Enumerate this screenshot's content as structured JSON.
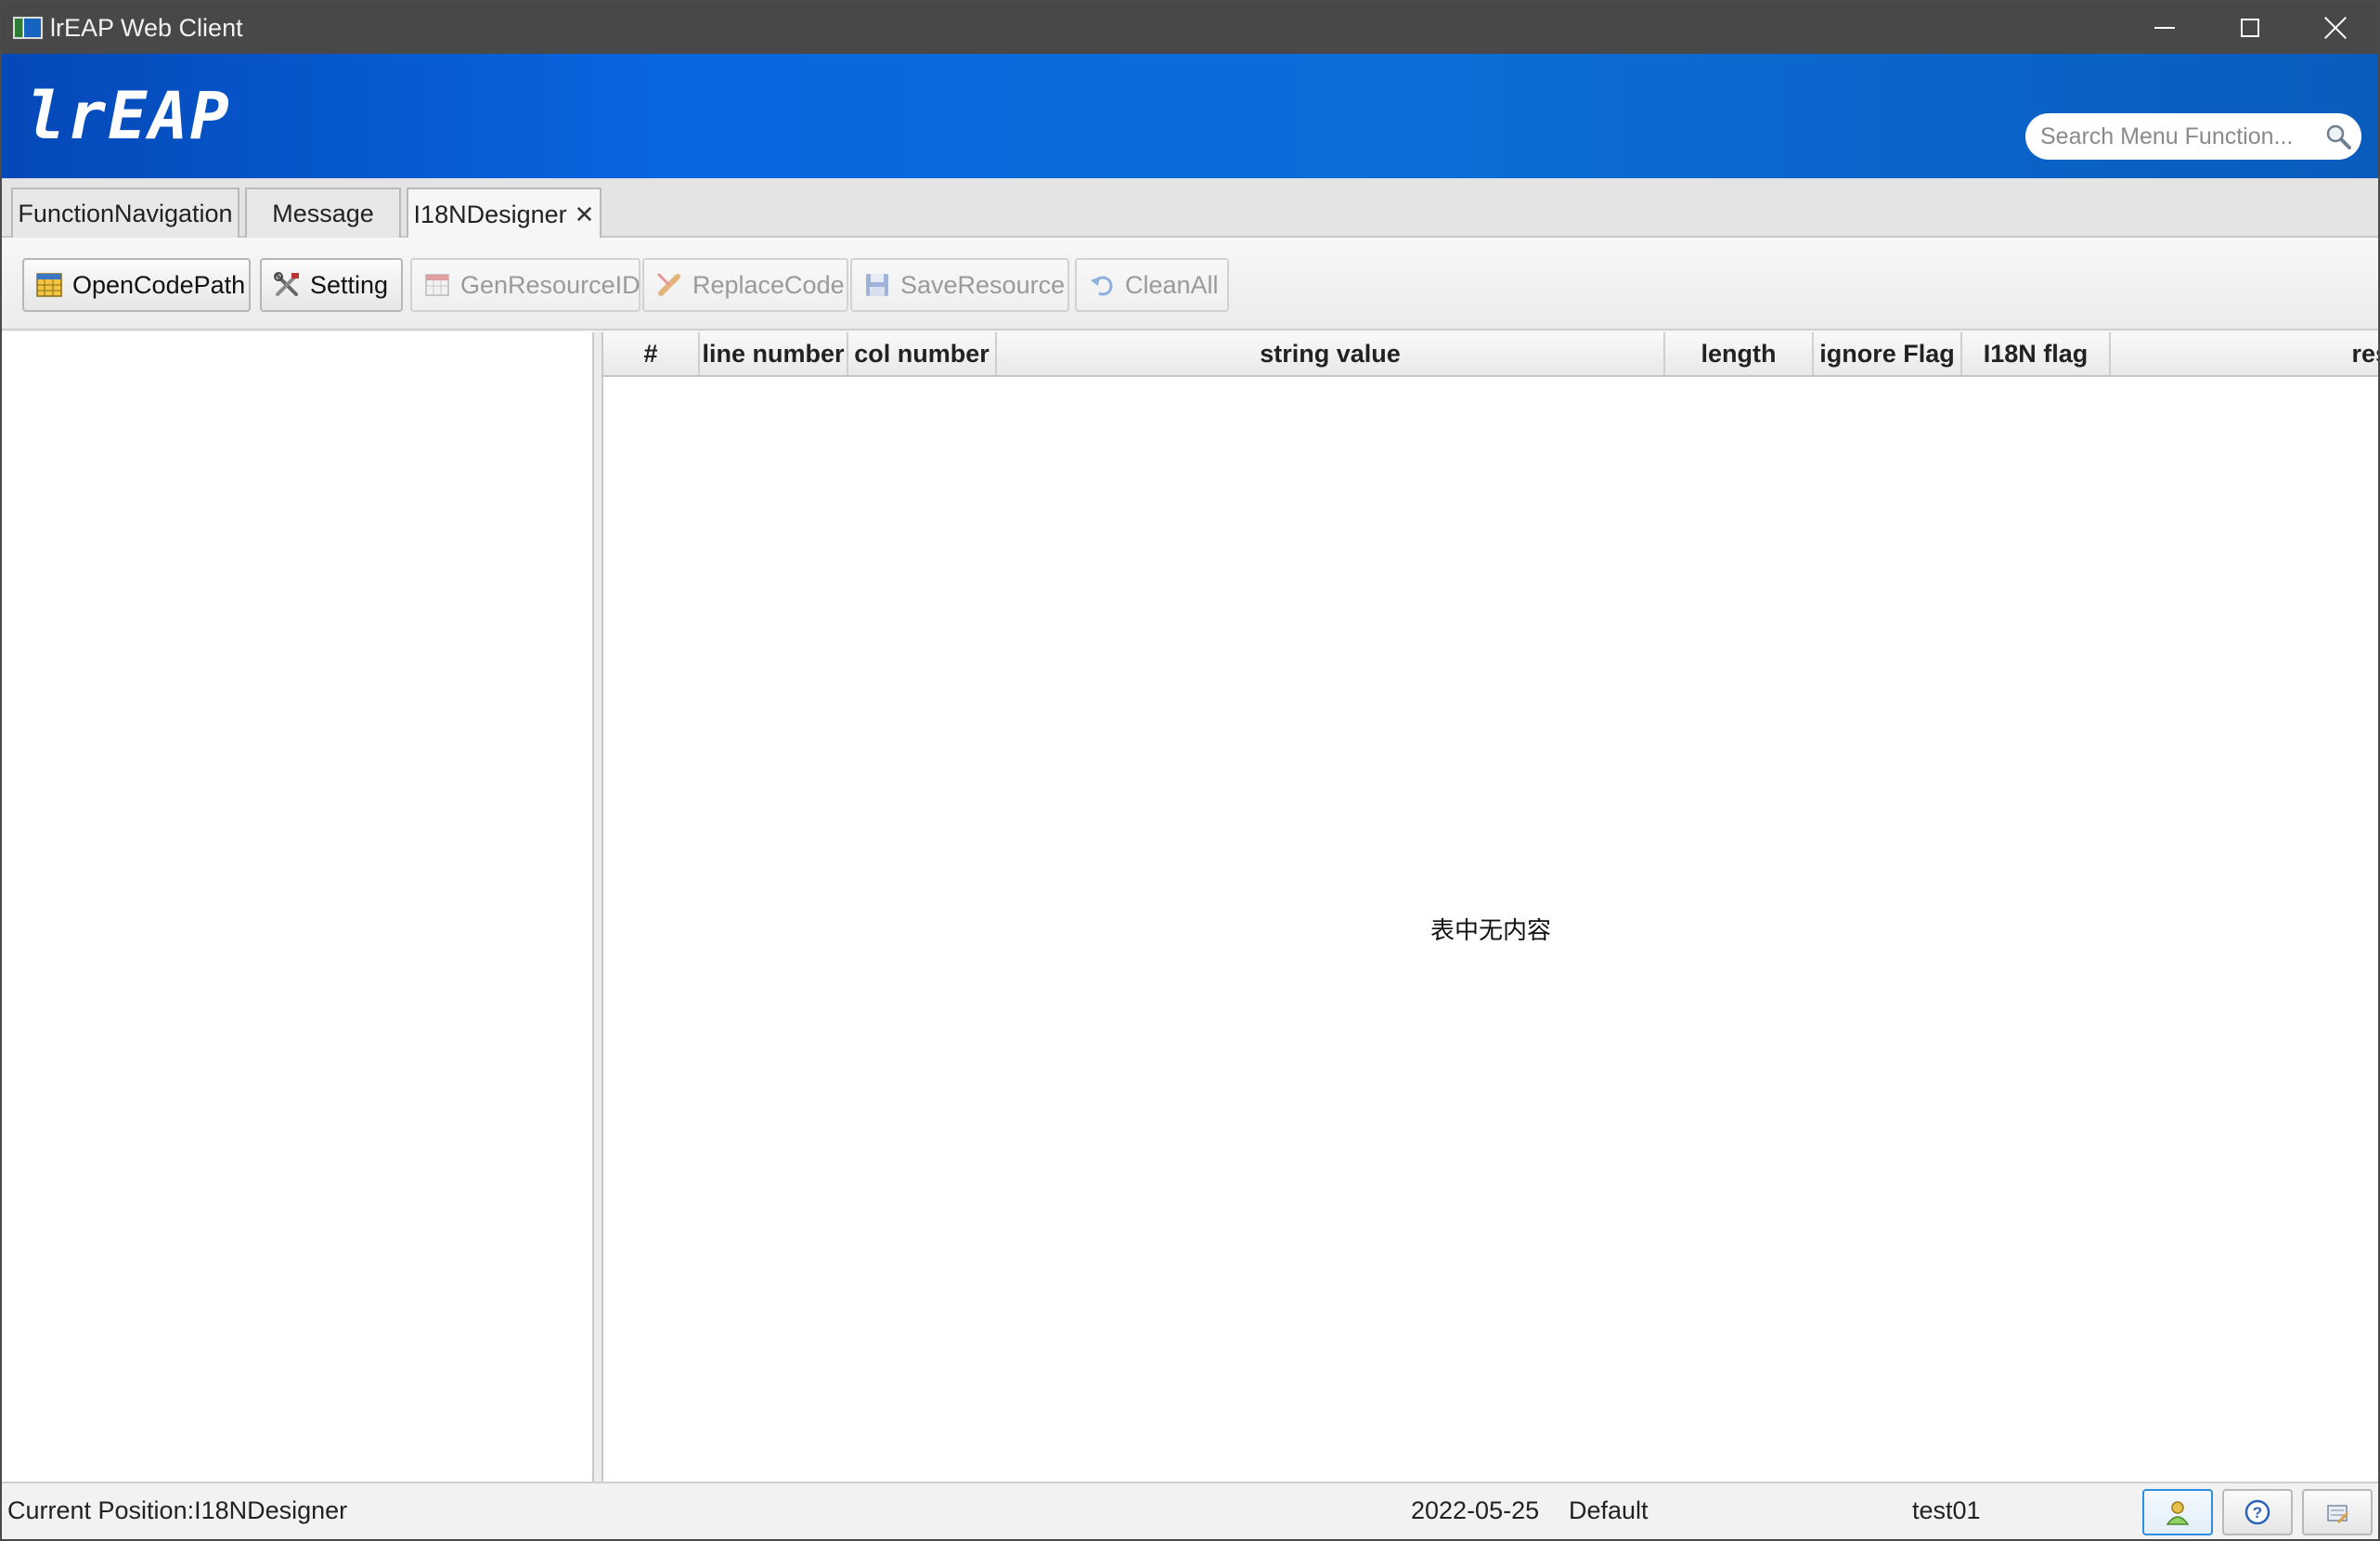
{
  "window": {
    "title": "lrEAP Web Client"
  },
  "header": {
    "logo": "lrEAP",
    "search_placeholder": "Search Menu Function..."
  },
  "tabs": [
    {
      "label": "FunctionNavigation",
      "active": false
    },
    {
      "label": "Message",
      "active": false
    },
    {
      "label": "I18NDesigner",
      "active": true,
      "close": "✕"
    }
  ],
  "toolbar": {
    "buttons": [
      {
        "label": "OpenCodePath",
        "enabled": true,
        "icon": "table-grid-icon"
      },
      {
        "label": "Setting",
        "enabled": true,
        "icon": "tools-icon"
      },
      {
        "label": "GenResourceID",
        "enabled": false,
        "icon": "calendar-table-icon"
      },
      {
        "label": "ReplaceCode",
        "enabled": false,
        "icon": "pencil-icon"
      },
      {
        "label": "SaveResource",
        "enabled": false,
        "icon": "floppy-disk-icon"
      },
      {
        "label": "CleanAll",
        "enabled": false,
        "icon": "undo-icon"
      }
    ]
  },
  "table": {
    "columns": [
      "#",
      "line number",
      "col number",
      "string value",
      "length",
      "ignore Flag",
      "I18N flag",
      "res"
    ],
    "rows": [],
    "empty_message": "表中无内容"
  },
  "status": {
    "position": "Current Position:I18NDesigner",
    "date": "2022-05-25",
    "profile": "Default",
    "user": "test01",
    "buttons": [
      "user-icon",
      "help-icon",
      "notes-icon"
    ]
  },
  "colors": {
    "titlebar": "#484848",
    "banner": "#0866e0",
    "accent_button": "#2f8ee0"
  }
}
